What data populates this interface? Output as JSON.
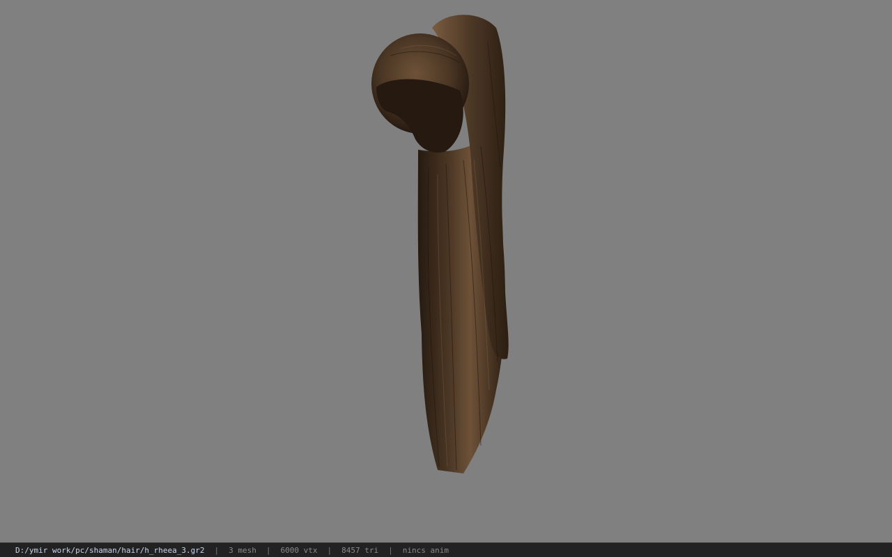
{
  "viewport": {
    "background_color": "#808080",
    "model": "hair mesh (ponytail)",
    "hair_colors": [
      "#3a2a1c",
      "#5a4430",
      "#7a5c40",
      "#261a10"
    ]
  },
  "status_bar": {
    "file_path": "D:/ymir work/pc/shaman/hair/h_rheea_3.gr2",
    "separator": "|",
    "mesh_count": "3 mesh",
    "vertex_count": "6000 vtx",
    "triangle_count": "8457 tri",
    "anim_status": "nincs anim"
  }
}
